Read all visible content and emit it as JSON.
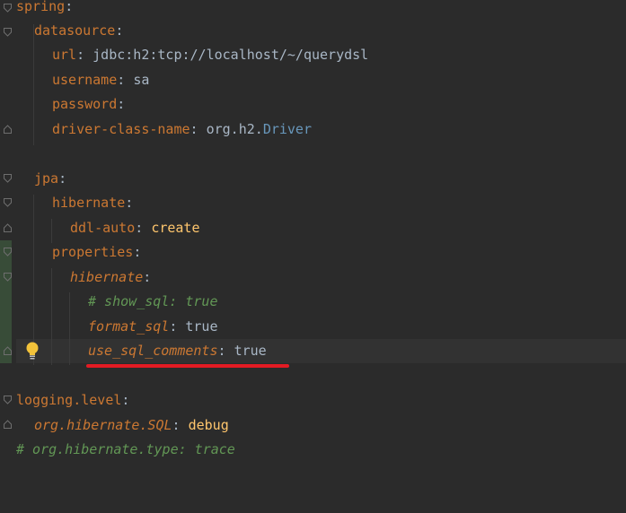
{
  "editor": {
    "lines": [
      {
        "key": "spring",
        "sep": ":"
      },
      {
        "key": "datasource",
        "sep": ":"
      },
      {
        "key": "url",
        "sep": ":",
        "value": "jdbc:h2:tcp://localhost/~/querydsl"
      },
      {
        "key": "username",
        "sep": ":",
        "value": "sa"
      },
      {
        "key": "password",
        "sep": ":"
      },
      {
        "key": "driver-class-name",
        "sep": ":",
        "value_a": "org.h2.",
        "value_b": "Driver"
      },
      {
        "key": "jpa",
        "sep": ":"
      },
      {
        "key": "hibernate",
        "sep": ":"
      },
      {
        "key": "ddl-auto",
        "sep": ":",
        "value": "create"
      },
      {
        "key": "properties",
        "sep": ":"
      },
      {
        "key": "hibernate",
        "sep": ":"
      },
      {
        "comment": "# show_sql: true"
      },
      {
        "key": "format_sql",
        "sep": ":",
        "value": "true"
      },
      {
        "key": "use_sql_comments",
        "sep": ":",
        "value": "true"
      },
      {
        "key": "logging.level",
        "sep": ":"
      },
      {
        "key": "org.hibernate.SQL",
        "sep": ":",
        "value": "debug"
      },
      {
        "comment": "# org.hibernate.type: trace"
      }
    ]
  },
  "gutter": {
    "intention_icon": "lightbulb-icon"
  },
  "annotation": {
    "color": "#e31b23"
  }
}
